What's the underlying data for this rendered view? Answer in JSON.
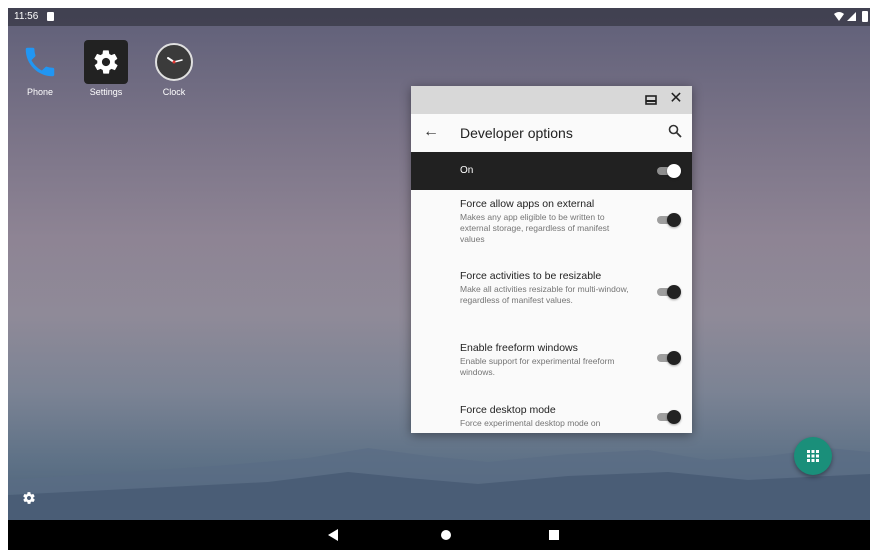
{
  "status_bar": {
    "time": "11:56"
  },
  "desktop_apps": [
    {
      "label": "Phone",
      "icon": "phone-icon"
    },
    {
      "label": "Settings",
      "icon": "gear-icon"
    },
    {
      "label": "Clock",
      "icon": "clock-icon"
    }
  ],
  "window": {
    "title": "Developer options",
    "master_switch": {
      "label": "On",
      "checked": true
    },
    "preferences": [
      {
        "title": "Force allow apps on external",
        "summary": "Makes any app eligible to be written to external storage, regardless of manifest values",
        "checked": true
      },
      {
        "title": "Force activities to be resizable",
        "summary": "Make all activities resizable for multi-window, regardless of manifest values.",
        "checked": true
      },
      {
        "title": "Enable freeform windows",
        "summary": "Enable support for experimental freeform windows.",
        "checked": true
      },
      {
        "title": "Force desktop mode",
        "summary": "Force experimental desktop mode on",
        "checked": true
      }
    ]
  },
  "colors": {
    "fab": "#1a8f7a",
    "master_bar": "#212121",
    "caption_bar": "#d8d8d8"
  }
}
